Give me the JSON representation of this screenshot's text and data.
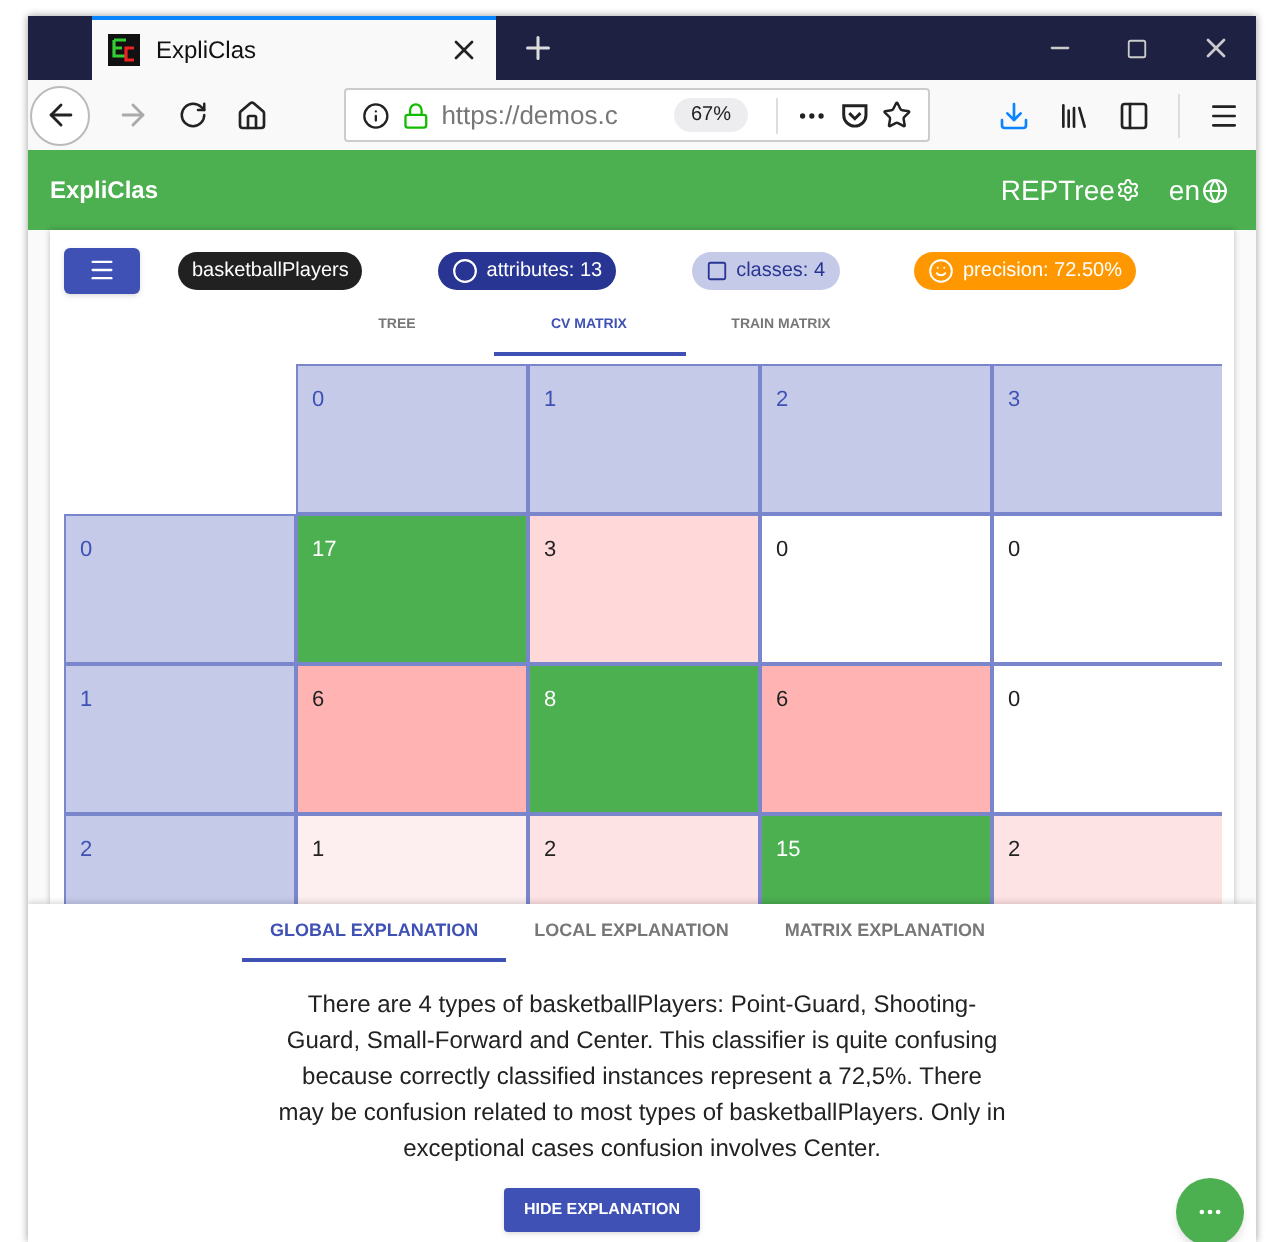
{
  "browser": {
    "tab_title": "ExpliClas",
    "url": "https://demos.c",
    "zoom": "67%"
  },
  "app_bar": {
    "title": "ExpliClas",
    "algorithm": "REPTree",
    "language": "en"
  },
  "chips": [
    {
      "kind": "dataset",
      "label": "basketballPlayers"
    },
    {
      "kind": "attributes",
      "label": "attributes: 13"
    },
    {
      "kind": "classes",
      "label": "classes: 4"
    },
    {
      "kind": "precision",
      "label": "precision: 72.50%"
    }
  ],
  "view_tabs": [
    {
      "label": "TREE",
      "selected": false
    },
    {
      "label": "CV MATRIX",
      "selected": true
    },
    {
      "label": "TRAIN MATRIX",
      "selected": false
    }
  ],
  "matrix": {
    "columns": [
      "0",
      "1",
      "2",
      "3"
    ],
    "rows": [
      {
        "label": "0",
        "cells": [
          {
            "value": "17",
            "color": "#4caf50"
          },
          {
            "value": "3",
            "color": "#ffd9d9"
          },
          {
            "value": "0",
            "color": "#ffffff"
          },
          {
            "value": "0",
            "color": "#ffffff"
          }
        ]
      },
      {
        "label": "1",
        "cells": [
          {
            "value": "6",
            "color": "#ffb3b3"
          },
          {
            "value": "8",
            "color": "#4caf50"
          },
          {
            "value": "6",
            "color": "#ffb3b3"
          },
          {
            "value": "0",
            "color": "#ffffff"
          }
        ]
      },
      {
        "label": "2",
        "cells": [
          {
            "value": "1",
            "color": "#fdefef"
          },
          {
            "value": "2",
            "color": "#fde3e3"
          },
          {
            "value": "15",
            "color": "#4caf50"
          },
          {
            "value": "2",
            "color": "#fde3e3"
          }
        ]
      }
    ]
  },
  "explanation_tabs": [
    {
      "label": "GLOBAL EXPLANATION",
      "selected": true
    },
    {
      "label": "LOCAL EXPLANATION",
      "selected": false
    },
    {
      "label": "MATRIX EXPLANATION",
      "selected": false
    }
  ],
  "explanation": "There are 4 types of basketballPlayers: Point-Guard, Shooting-Guard, Small-Forward and Center. This classifier is quite confusing because correctly classified instances represent a 72,5%. There may be confusion related to most types of basketballPlayers. Only in exceptional cases confusion involves Center.",
  "hide_button": "HIDE EXPLANATION"
}
